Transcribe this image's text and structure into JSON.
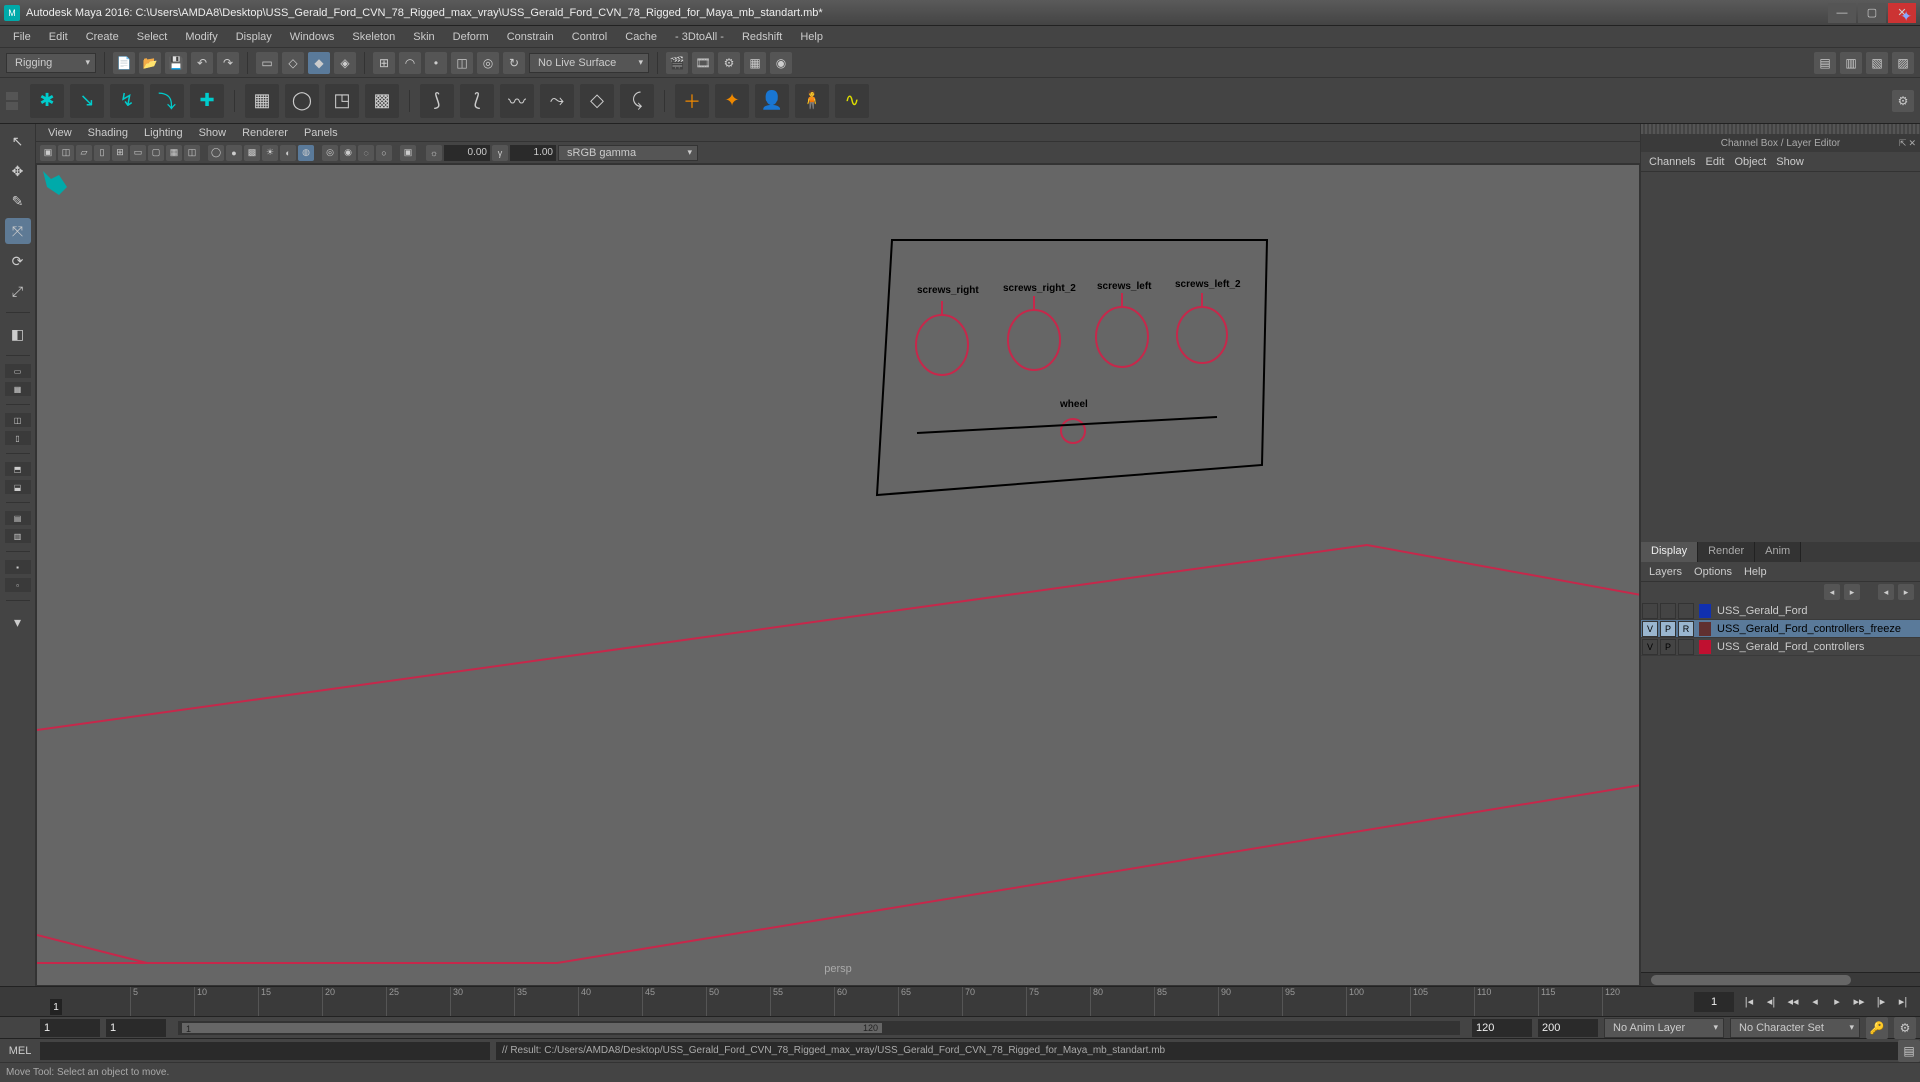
{
  "window": {
    "title": "Autodesk Maya 2016: C:\\Users\\AMDA8\\Desktop\\USS_Gerald_Ford_CVN_78_Rigged_max_vray\\USS_Gerald_Ford_CVN_78_Rigged_for_Maya_mb_standart.mb*"
  },
  "main_menu": [
    "File",
    "Edit",
    "Create",
    "Select",
    "Modify",
    "Display",
    "Windows",
    "Skeleton",
    "Skin",
    "Deform",
    "Constrain",
    "Control",
    "Cache",
    "- 3DtoAll -",
    "Redshift",
    "Help"
  ],
  "module_dropdown": "Rigging",
  "live_surface": "No Live Surface",
  "panel_menu": [
    "View",
    "Shading",
    "Lighting",
    "Show",
    "Renderer",
    "Panels"
  ],
  "panel_toolbar": {
    "exposure": "0.00",
    "gamma": "1.00",
    "colorspace": "sRGB gamma"
  },
  "viewport": {
    "label": "persp"
  },
  "hud_labels": {
    "c1": "screws_right",
    "c2": "screws_right_2",
    "c3": "screws_left",
    "c4": "screws_left_2",
    "wheel": "wheel"
  },
  "channel_box": {
    "title": "Channel Box / Layer Editor",
    "menu": [
      "Channels",
      "Edit",
      "Object",
      "Show"
    ]
  },
  "tabs": [
    "Display",
    "Render",
    "Anim"
  ],
  "layer_menu": [
    "Layers",
    "Options",
    "Help"
  ],
  "layers": [
    {
      "v": "",
      "p": "",
      "r": "",
      "color": "#1030b0",
      "name": "USS_Gerald_Ford",
      "sel": false
    },
    {
      "v": "V",
      "p": "P",
      "r": "R",
      "color": "#603030",
      "name": "USS_Gerald_Ford_controllers_freeze",
      "sel": true
    },
    {
      "v": "V",
      "p": "P",
      "r": "",
      "color": "#c01030",
      "name": "USS_Gerald_Ford_controllers",
      "sel": false
    }
  ],
  "timeline": {
    "ticks": [
      "5",
      "10",
      "15",
      "20",
      "25",
      "30",
      "35",
      "40",
      "45",
      "50",
      "55",
      "60",
      "65",
      "70",
      "75",
      "80",
      "85",
      "90",
      "95",
      "100",
      "105",
      "110",
      "115",
      "120"
    ],
    "current_label": "1",
    "end_field": "1"
  },
  "range": {
    "start_outer": "1",
    "start_inner": "1",
    "end_inner": "120",
    "end_outer": "200",
    "slider_start": "1",
    "slider_end": "120",
    "anim_layer": "No Anim Layer",
    "char_set": "No Character Set"
  },
  "cmdline": {
    "label": "MEL",
    "result": "// Result: C:/Users/AMDA8/Desktop/USS_Gerald_Ford_CVN_78_Rigged_max_vray/USS_Gerald_Ford_CVN_78_Rigged_for_Maya_mb_standart.mb"
  },
  "status": "Move Tool: Select an object to move."
}
